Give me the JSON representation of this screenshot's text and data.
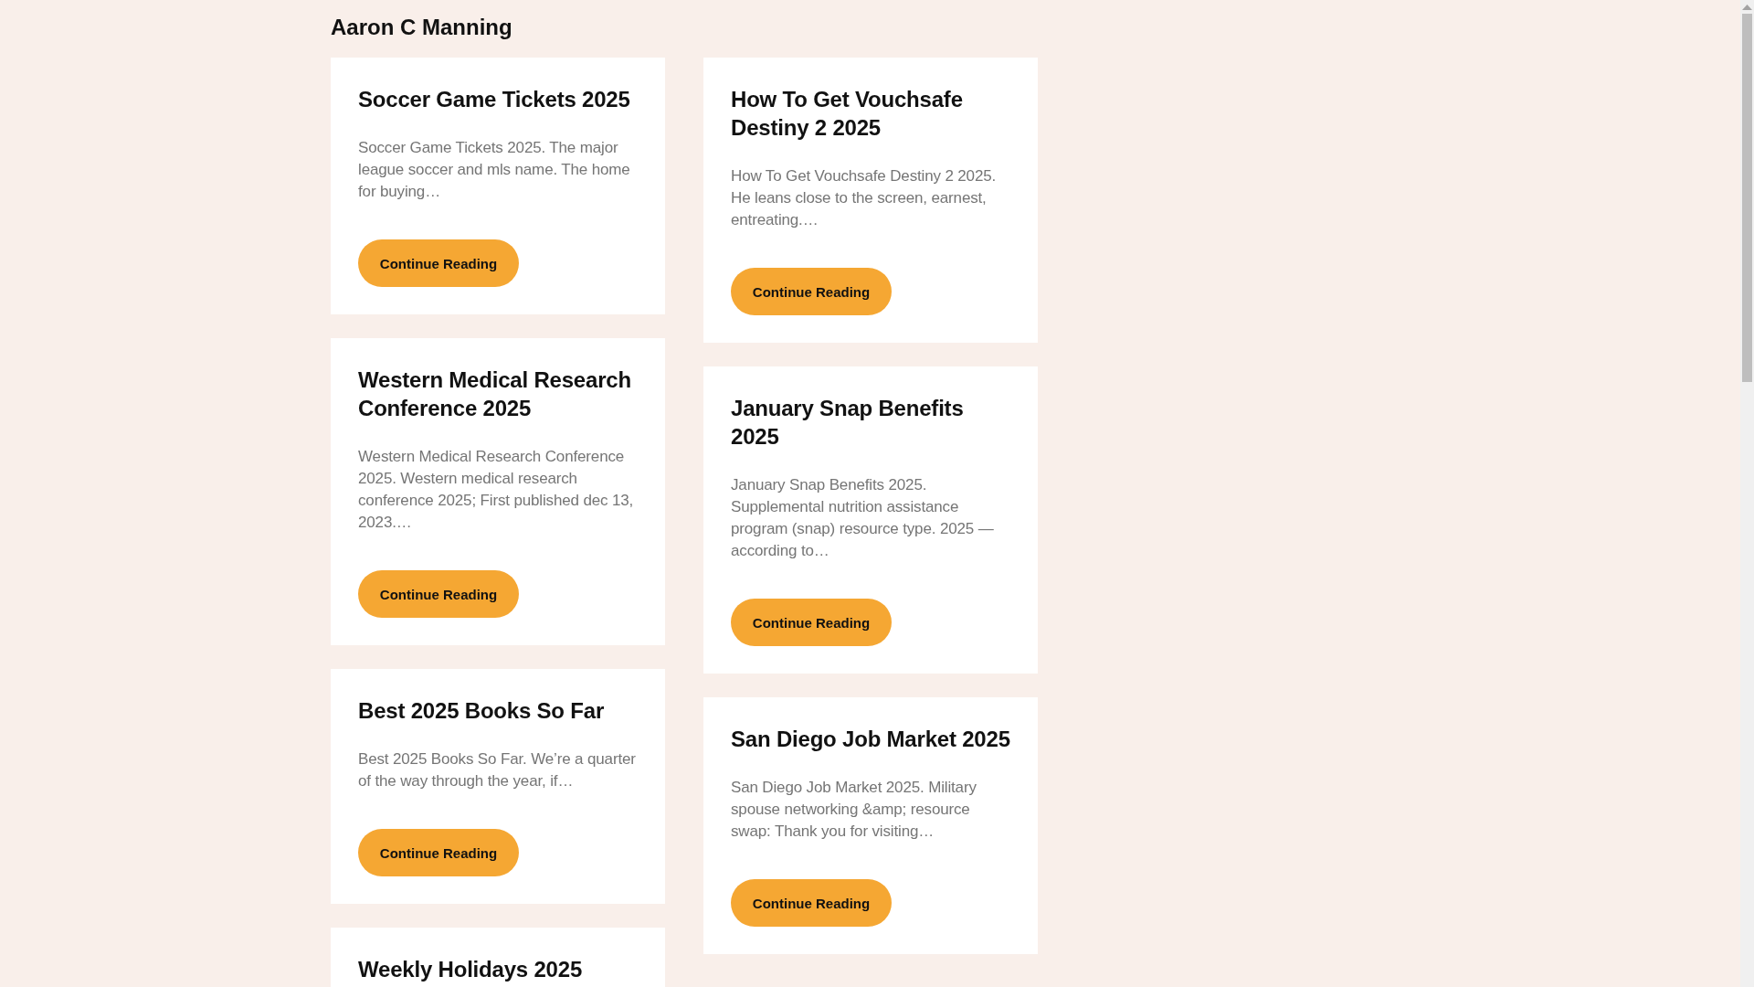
{
  "site_title": "Aaron C Manning",
  "columns": [
    {
      "posts": [
        {
          "title": "Soccer Game Tickets 2025",
          "excerpt": "Soccer Game Tickets 2025. The major league soccer and mls name. The home for buying…",
          "button": "Continue Reading"
        },
        {
          "title": "Western Medical Research Conference 2025",
          "excerpt": "Western Medical Research Conference 2025. Western medical research conference 2025; First published dec 13, 2023.…",
          "button": "Continue Reading"
        },
        {
          "title": "Best 2025 Books So Far",
          "excerpt": "Best 2025 Books So Far. We’re a quarter of the way through the year, if…",
          "button": "Continue Reading"
        },
        {
          "title": "Weekly Holidays 2025"
        }
      ]
    },
    {
      "posts": [
        {
          "title": "How To Get Vouchsafe Destiny 2 2025",
          "excerpt": "How To Get Vouchsafe Destiny 2 2025. He leans close to the screen, earnest, entreating.…",
          "button": "Continue Reading"
        },
        {
          "title": "January Snap Benefits 2025",
          "excerpt": "January Snap Benefits 2025. Supplemental nutrition assistance program (snap) resource type. 2025 — according to…",
          "button": "Continue Reading"
        },
        {
          "title": "San Diego Job Market 2025",
          "excerpt": "San Diego Job Market 2025. Military spouse networking &amp; resource swap: Thank you for visiting…",
          "button": "Continue Reading"
        }
      ]
    }
  ]
}
